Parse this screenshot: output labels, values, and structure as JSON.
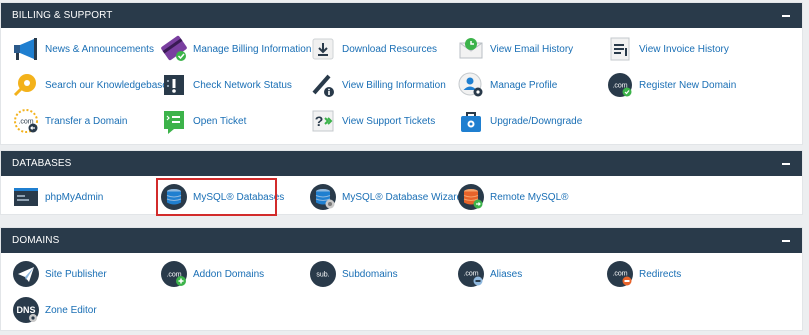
{
  "sections": {
    "billing": {
      "title": "BILLING & SUPPORT",
      "items": [
        {
          "label": "News & Announcements",
          "icon": "megaphone-icon"
        },
        {
          "label": "Manage Billing Information",
          "icon": "credit-card-icon"
        },
        {
          "label": "Download Resources",
          "icon": "download-icon"
        },
        {
          "label": "View Email History",
          "icon": "email-history-icon"
        },
        {
          "label": "View Invoice History",
          "icon": "invoice-icon"
        },
        {
          "label": "Search our Knowledgebase",
          "icon": "key-search-icon"
        },
        {
          "label": "Check Network Status",
          "icon": "network-status-icon"
        },
        {
          "label": "View Billing Information",
          "icon": "billing-info-icon"
        },
        {
          "label": "Manage Profile",
          "icon": "profile-icon"
        },
        {
          "label": "Register New Domain",
          "icon": "register-domain-icon"
        },
        {
          "label": "Transfer a Domain",
          "icon": "transfer-domain-icon"
        },
        {
          "label": "Open Ticket",
          "icon": "ticket-icon"
        },
        {
          "label": "View Support Tickets",
          "icon": "support-tickets-icon"
        },
        {
          "label": "Upgrade/Downgrade",
          "icon": "upgrade-icon"
        }
      ]
    },
    "databases": {
      "title": "DATABASES",
      "items": [
        {
          "label": "phpMyAdmin",
          "icon": "phpmyadmin-icon"
        },
        {
          "label": "MySQL® Databases",
          "icon": "mysql-database-icon"
        },
        {
          "label": "MySQL® Database Wizard",
          "icon": "database-wizard-icon"
        },
        {
          "label": "Remote MySQL®",
          "icon": "remote-mysql-icon"
        }
      ]
    },
    "domains": {
      "title": "DOMAINS",
      "items": [
        {
          "label": "Site Publisher",
          "icon": "site-publisher-icon"
        },
        {
          "label": "Addon Domains",
          "icon": "addon-domains-icon"
        },
        {
          "label": "Subdomains",
          "icon": "subdomains-icon"
        },
        {
          "label": "Aliases",
          "icon": "aliases-icon"
        },
        {
          "label": "Redirects",
          "icon": "redirects-icon"
        },
        {
          "label": "Zone Editor",
          "icon": "zone-editor-icon"
        }
      ]
    }
  },
  "icon_text": {
    "com": ".com",
    "sub": "sub.",
    "dns": "DNS"
  },
  "colors": {
    "header_bg": "#293a4a",
    "link": "#1a6fb5",
    "highlight": "#d22b2b"
  }
}
